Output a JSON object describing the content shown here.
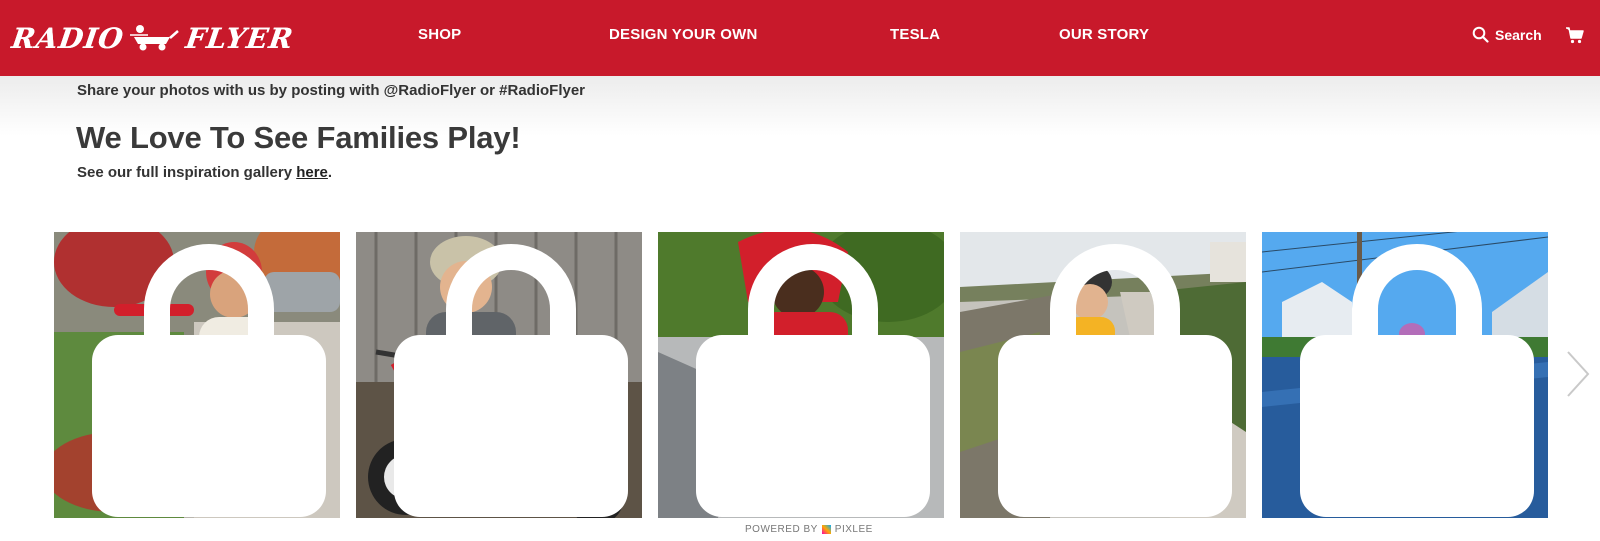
{
  "header": {
    "logo_left": "RADIO",
    "logo_right": "FLYER",
    "nav": [
      "SHOP",
      "DESIGN YOUR OWN",
      "TESLA",
      "OUR STORY"
    ],
    "search_label": "Search",
    "bg_color": "#c8192b"
  },
  "intro": {
    "share_text": "Share your photos with us by posting with @RadioFlyer or #RadioFlyer",
    "headline": "We Love To See Families Play!",
    "gallery_prefix": "See our full inspiration gallery ",
    "gallery_link": "here",
    "gallery_suffix": "."
  },
  "gallery": {
    "tiles": [
      {
        "icon": "shopping-bag-icon",
        "subject": "toddler on red scooter"
      },
      {
        "icon": "shopping-bag-icon",
        "subject": "child on red tricycle"
      },
      {
        "icon": "shopping-bag-icon",
        "subject": "baby in red stroll trike"
      },
      {
        "icon": "shopping-bag-icon",
        "subject": "child on balance bike"
      },
      {
        "icon": "shopping-bag-icon",
        "subject": "child on tricycle in street"
      }
    ],
    "next_icon": "chevron-right-icon",
    "powered_prefix": "POWERED BY",
    "powered_brand": "PIXLEE"
  }
}
